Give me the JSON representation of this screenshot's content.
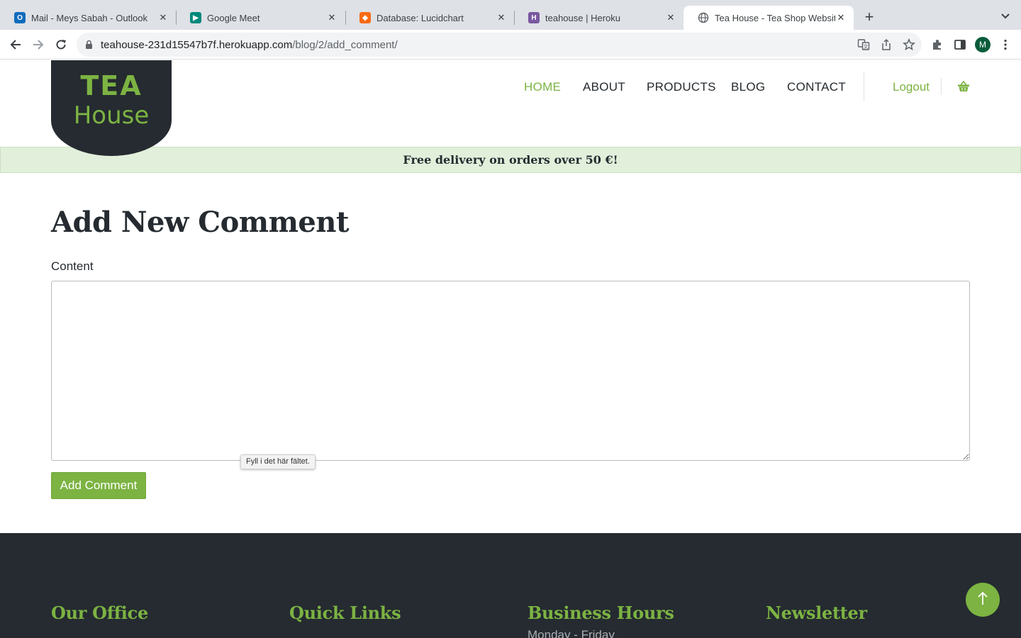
{
  "browser": {
    "tabs": [
      {
        "title": "Mail - Meys Sabah - Outlook",
        "icon": "outlook-icon",
        "color": "#0f6cbd"
      },
      {
        "title": "Google Meet",
        "icon": "google-meet-icon",
        "color": "#00897b"
      },
      {
        "title": "Database: Lucidchart",
        "icon": "lucidchart-icon",
        "color": "#f96b13"
      },
      {
        "title": "teahouse | Heroku",
        "icon": "heroku-icon",
        "color": "#79589f"
      },
      {
        "title": "Tea House - Tea Shop Website",
        "icon": "globe-icon",
        "color": "#5f6368"
      }
    ],
    "url_host": "teahouse-231d15547b7f.herokuapp.com",
    "url_path": "/blog/2/add_comment/",
    "profile_initial": "M"
  },
  "site": {
    "logo": {
      "line1": "TEA",
      "line2": "House"
    },
    "nav": {
      "items": [
        "HOME",
        "ABOUT",
        "PRODUCTS",
        "BLOG",
        "CONTACT"
      ],
      "active": "HOME",
      "logout": "Logout"
    },
    "banner": "Free delivery on orders over 50 €!",
    "form": {
      "title": "Add New Comment",
      "content_label": "Content",
      "content_value": "",
      "validation_tooltip": "Fyll i det här fältet.",
      "submit_label": "Add Comment"
    },
    "footer": {
      "headings": [
        "Our Office",
        "Quick Links",
        "Business Hours",
        "Newsletter"
      ],
      "business_hours_sub": "Monday - Friday"
    },
    "colors": {
      "accent": "#7cb342",
      "dark": "#252b30",
      "banner_bg": "#e2efdb"
    }
  }
}
